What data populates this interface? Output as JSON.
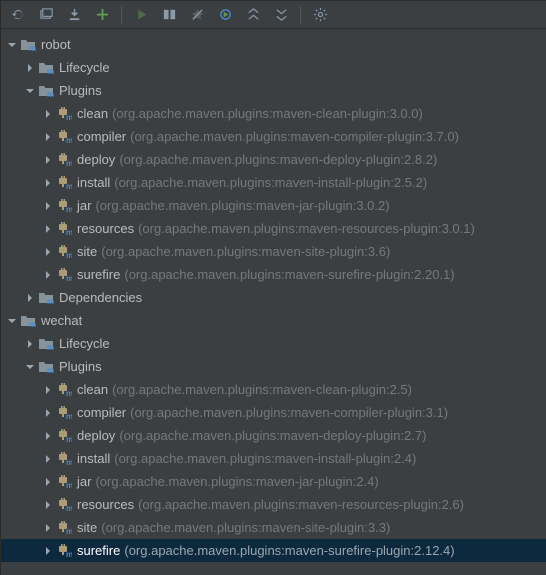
{
  "toolbar": {
    "icons": [
      "refresh",
      "generate",
      "download",
      "add",
      "run",
      "run-goal",
      "toggle",
      "execute",
      "expand",
      "collapse",
      "settings"
    ]
  },
  "projects": [
    {
      "name": "robot",
      "expanded": true,
      "children": [
        {
          "name": "Lifecycle",
          "type": "folder",
          "expanded": false
        },
        {
          "name": "Plugins",
          "type": "folder",
          "expanded": true,
          "children": [
            {
              "name": "clean",
              "artifact": "(org.apache.maven.plugins:maven-clean-plugin:3.0.0)"
            },
            {
              "name": "compiler",
              "artifact": "(org.apache.maven.plugins:maven-compiler-plugin:3.7.0)"
            },
            {
              "name": "deploy",
              "artifact": "(org.apache.maven.plugins:maven-deploy-plugin:2.8.2)"
            },
            {
              "name": "install",
              "artifact": "(org.apache.maven.plugins:maven-install-plugin:2.5.2)"
            },
            {
              "name": "jar",
              "artifact": "(org.apache.maven.plugins:maven-jar-plugin:3.0.2)"
            },
            {
              "name": "resources",
              "artifact": "(org.apache.maven.plugins:maven-resources-plugin:3.0.1)"
            },
            {
              "name": "site",
              "artifact": "(org.apache.maven.plugins:maven-site-plugin:3.6)"
            },
            {
              "name": "surefire",
              "artifact": "(org.apache.maven.plugins:maven-surefire-plugin:2.20.1)"
            }
          ]
        },
        {
          "name": "Dependencies",
          "type": "folder",
          "expanded": false
        }
      ]
    },
    {
      "name": "wechat",
      "expanded": true,
      "children": [
        {
          "name": "Lifecycle",
          "type": "folder",
          "expanded": false
        },
        {
          "name": "Plugins",
          "type": "folder",
          "expanded": true,
          "children": [
            {
              "name": "clean",
              "artifact": "(org.apache.maven.plugins:maven-clean-plugin:2.5)"
            },
            {
              "name": "compiler",
              "artifact": "(org.apache.maven.plugins:maven-compiler-plugin:3.1)"
            },
            {
              "name": "deploy",
              "artifact": "(org.apache.maven.plugins:maven-deploy-plugin:2.7)"
            },
            {
              "name": "install",
              "artifact": "(org.apache.maven.plugins:maven-install-plugin:2.4)"
            },
            {
              "name": "jar",
              "artifact": "(org.apache.maven.plugins:maven-jar-plugin:2.4)"
            },
            {
              "name": "resources",
              "artifact": "(org.apache.maven.plugins:maven-resources-plugin:2.6)"
            },
            {
              "name": "site",
              "artifact": "(org.apache.maven.plugins:maven-site-plugin:3.3)"
            },
            {
              "name": "surefire",
              "artifact": "(org.apache.maven.plugins:maven-surefire-plugin:2.12.4)",
              "selected": true
            }
          ]
        }
      ]
    }
  ]
}
